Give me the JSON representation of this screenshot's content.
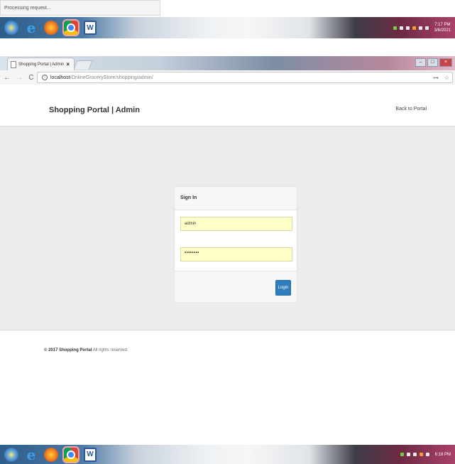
{
  "status_tooltip": "Processing request...",
  "taskbar_top": {
    "clock_time": "7:17 PM",
    "clock_date": "3/6/2021"
  },
  "taskbar_bottom": {
    "clock_time": "6:18 PM"
  },
  "browser": {
    "tab_title": "Shopping Portal | Admin",
    "tab_close": "×",
    "url_host": "localhost",
    "url_path": "/OnlineGroceryStore/shopping/admin/",
    "back": "←",
    "forward": "→",
    "reload": "C",
    "star": "☆",
    "key": "⊶",
    "win_min": "–",
    "win_max": "□",
    "win_close": "×"
  },
  "page": {
    "brand": "Shopping Portal | Admin",
    "back_link": "Back to Portal",
    "signin_title": "Sign In",
    "username_value": "admin",
    "password_value": "••••••••",
    "login_label": "Login",
    "copyright_bold": "© 2017 Shopping Portal",
    "copyright_rest": " All rights reserved."
  },
  "colors": {
    "primary_button": "#2e7ebd",
    "autofill": "#ffffc8",
    "band": "#ececec"
  }
}
